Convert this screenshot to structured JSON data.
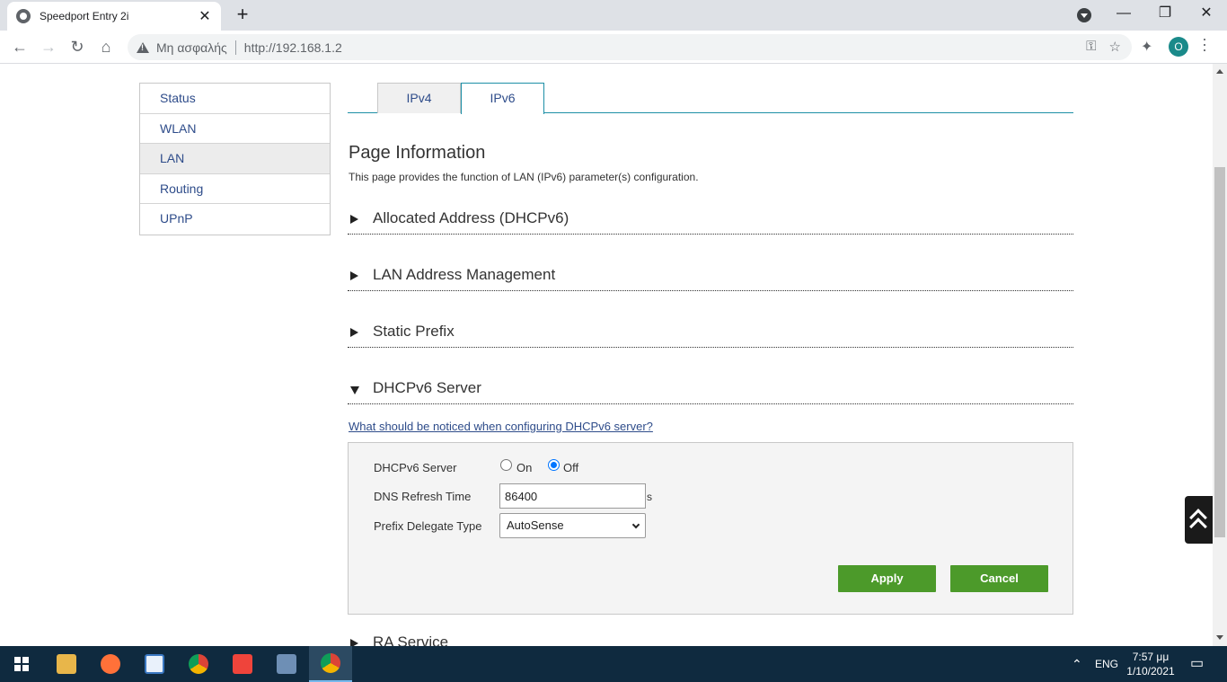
{
  "browser": {
    "tab_title": "Speedport Entry 2i",
    "insecure_label": "Μη ασφαλής",
    "url": "http://192.168.1.2",
    "profile_initial": "O"
  },
  "sidenav": {
    "items": [
      {
        "label": "Status"
      },
      {
        "label": "WLAN"
      },
      {
        "label": "LAN"
      },
      {
        "label": "Routing"
      },
      {
        "label": "UPnP"
      }
    ],
    "active": "LAN"
  },
  "tabs": [
    {
      "label": "IPv4"
    },
    {
      "label": "IPv6"
    }
  ],
  "active_tab": "IPv6",
  "page": {
    "title": "Page Information",
    "description": "This page provides the function of LAN (IPv6) parameter(s) configuration."
  },
  "sections": [
    {
      "label": "Allocated Address (DHCPv6)",
      "expanded": false
    },
    {
      "label": "LAN Address Management",
      "expanded": false
    },
    {
      "label": "Static Prefix",
      "expanded": false
    },
    {
      "label": "DHCPv6 Server",
      "expanded": true
    },
    {
      "label": "RA Service",
      "expanded": false
    }
  ],
  "dhcp": {
    "help_link": "What should be noticed when configuring DHCPv6 server?",
    "server_label": "DHCPv6 Server",
    "on_label": "On",
    "off_label": "Off",
    "server_value": "Off",
    "dns_label": "DNS Refresh Time",
    "dns_value": "86400",
    "dns_unit": "s",
    "prefix_label": "Prefix Delegate Type",
    "prefix_value": "AutoSense",
    "apply_label": "Apply",
    "cancel_label": "Cancel"
  },
  "colors": {
    "link": "#2e4c8a",
    "accent": "#1d8fa6",
    "button": "#4c9a2a"
  },
  "taskbar": {
    "language": "ENG",
    "time": "7:57 μμ",
    "date": "1/10/2021"
  }
}
